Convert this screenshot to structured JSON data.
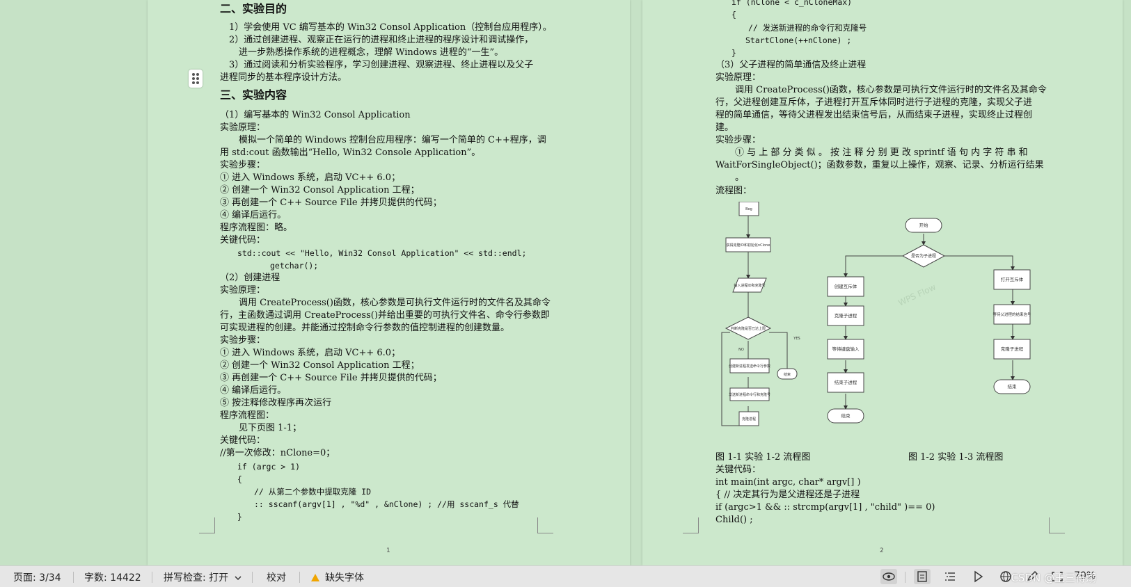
{
  "page1": {
    "page_number": "1",
    "lines": [
      {
        "text": "二、实验目的",
        "style": "h"
      },
      {
        "text": "1）学会使用 VC 编写基本的 Win32 Consol Application（控制台应用程序）。"
      },
      {
        "text": "2）通过创建进程、观察正在运行的进程和终止进程的程序设计和调试操作，"
      },
      {
        "text": "进一步熟悉操作系统的进程概念，理解 Windows 进程的“一生”。"
      },
      {
        "text": "3）通过阅读和分析实验程序，学习创建进程、观察进程、终止进程以及父子"
      },
      {
        "text": "进程同步的基本程序设计方法。"
      },
      {
        "text": "三、实验内容",
        "style": "h"
      },
      {
        "text": "（1）编写基本的 Win32 Consol Application"
      },
      {
        "text": "实验原理："
      },
      {
        "text": "模拟一个简单的 Windows 控制台应用程序：编写一个简单的 C++程序，调"
      },
      {
        "text": "用 std:cout 函数输出“Hello, Win32 Console Application”。"
      },
      {
        "text": "实验步骤："
      },
      {
        "text": "①  进入 Windows 系统，启动 VC++ 6.0；"
      },
      {
        "text": "②  创建一个 Win32 Consol Application 工程；"
      },
      {
        "text": "③  再创建一个 C++ Source File 并拷贝提供的代码；"
      },
      {
        "text": "④  编译后运行。"
      },
      {
        "text": "程序流程图：略。"
      },
      {
        "text": "关键代码："
      },
      {
        "text": "std::cout << \"Hello, Win32 Consol Application\" << std::endl;",
        "style": "mono"
      },
      {
        "text": "getchar();",
        "style": "mono"
      },
      {
        "text": "（2）创建进程"
      },
      {
        "text": "实验原理："
      },
      {
        "text": "调用 CreateProcess()函数，核心参数是可执行文件运行时的文件名及其命令"
      },
      {
        "text": "行，主函数通过调用 CreateProcess()并给出重要的可执行文件名、命令行参数即"
      },
      {
        "text": "可实现进程的创建。并能通过控制命令行参数的值控制进程的创建数量。"
      },
      {
        "text": "实验步骤："
      },
      {
        "text": "①  进入 Windows 系统，启动 VC++ 6.0；"
      },
      {
        "text": "②  创建一个 Win32 Consol Application 工程；"
      },
      {
        "text": "③  再创建一个 C++ Source File 并拷贝提供的代码；"
      },
      {
        "text": "④  编译后运行。"
      },
      {
        "text": "⑤  按注释修改程序再次运行"
      },
      {
        "text": "程序流程图："
      },
      {
        "text": "见下页图 1-1；"
      },
      {
        "text": "关键代码："
      },
      {
        "text": "//第一次修改：nClone=0；"
      },
      {
        "text": "if (argc > 1)",
        "style": "mono"
      },
      {
        "text": "{",
        "style": "mono"
      },
      {
        "text": "// 从第二个参数中提取克隆 ID",
        "style": "mono"
      },
      {
        "text": ":: sscanf(argv[1] , \"%d\" , &nClone) ; //用 sscanf_s 代替",
        "style": "mono"
      },
      {
        "text": "}",
        "style": "mono"
      }
    ]
  },
  "page2": {
    "page_number": "2",
    "lines": [
      {
        "text": "if (nClone < c_nCloneMax)",
        "style": "mono"
      },
      {
        "text": "{",
        "style": "mono"
      },
      {
        "text": "// 发送新进程的命令行和克隆号",
        "style": "mono"
      },
      {
        "text": "StartClone(++nClone) ;",
        "style": "mono"
      },
      {
        "text": "}",
        "style": "mono"
      },
      {
        "text": "（3）父子进程的简单通信及终止进程"
      },
      {
        "text": "实验原理："
      },
      {
        "text": "调用 CreateProcess()函数，核心参数是可执行文件运行时的文件名及其命令"
      },
      {
        "text": "行，父进程创建互斥体，子进程打开互斥体同时进行子进程的克隆，实现父子进"
      },
      {
        "text": "程的简单通信，等待父进程发出结束信号后，从而结束子进程，实现终止过程创"
      },
      {
        "text": "建。"
      },
      {
        "text": "实验步骤："
      },
      {
        "text": "①  与 上 部 分 类 似 。 按 注 释 分 别 更 改  sprintf  语 句 内 字 符 串 和"
      },
      {
        "text": "WaitForSingleObject()；函数参数，重复以上操作，观察、记录、分析运行结果"
      },
      {
        "text": "。"
      },
      {
        "text": "流程图："
      },
      {
        "text": "图 1-1  实验 1-2 流程图"
      },
      {
        "text": "图 1-2  实验 1-3 流程图"
      },
      {
        "text": "关键代码："
      },
      {
        "text": "int main(int argc, char* argv[] )"
      },
      {
        "text": "{ // 决定其行为是父进程还是子进程"
      },
      {
        "text": "if (argc>1 && :: strcmp(argv[1] , \"child\" )== 0)"
      },
      {
        "text": "Child() ;"
      }
    ]
  },
  "flowchart1": {
    "nodes": [
      "Beg",
      "获得克隆ID和初始化nClone",
      "输入进程ID和克隆号",
      "判断克隆是否已达上限",
      "创建新进程发送命令行参数",
      "发送新进程命令行和克隆号",
      "克隆进程",
      "结束"
    ],
    "branch_labels": [
      "NO",
      "YES"
    ]
  },
  "flowchart2": {
    "nodes": [
      "开始",
      "是否为子进程",
      "创建互斥体",
      "克隆子进程",
      "等待键盘输入",
      "结束子进程",
      "结束",
      "打开互斥体",
      "等待父进程的结束信号",
      "克隆子进程",
      "结束"
    ],
    "watermark": "WPS Flow"
  },
  "statusbar": {
    "page": "页面: 3/34",
    "word_count": "字数: 14422",
    "spell_check": "拼写检查: 打开",
    "proofread": "校对",
    "missing_fonts": "缺失字体",
    "zoom": "70%",
    "watermark": "CSDN @王三得溺"
  },
  "icons": [
    "drag-handle-icon",
    "eye-icon",
    "page-view-icon",
    "outline-view-icon",
    "play-icon",
    "globe-icon",
    "pen-icon",
    "fit-icon",
    "warning-icon",
    "chevron-down-icon"
  ]
}
